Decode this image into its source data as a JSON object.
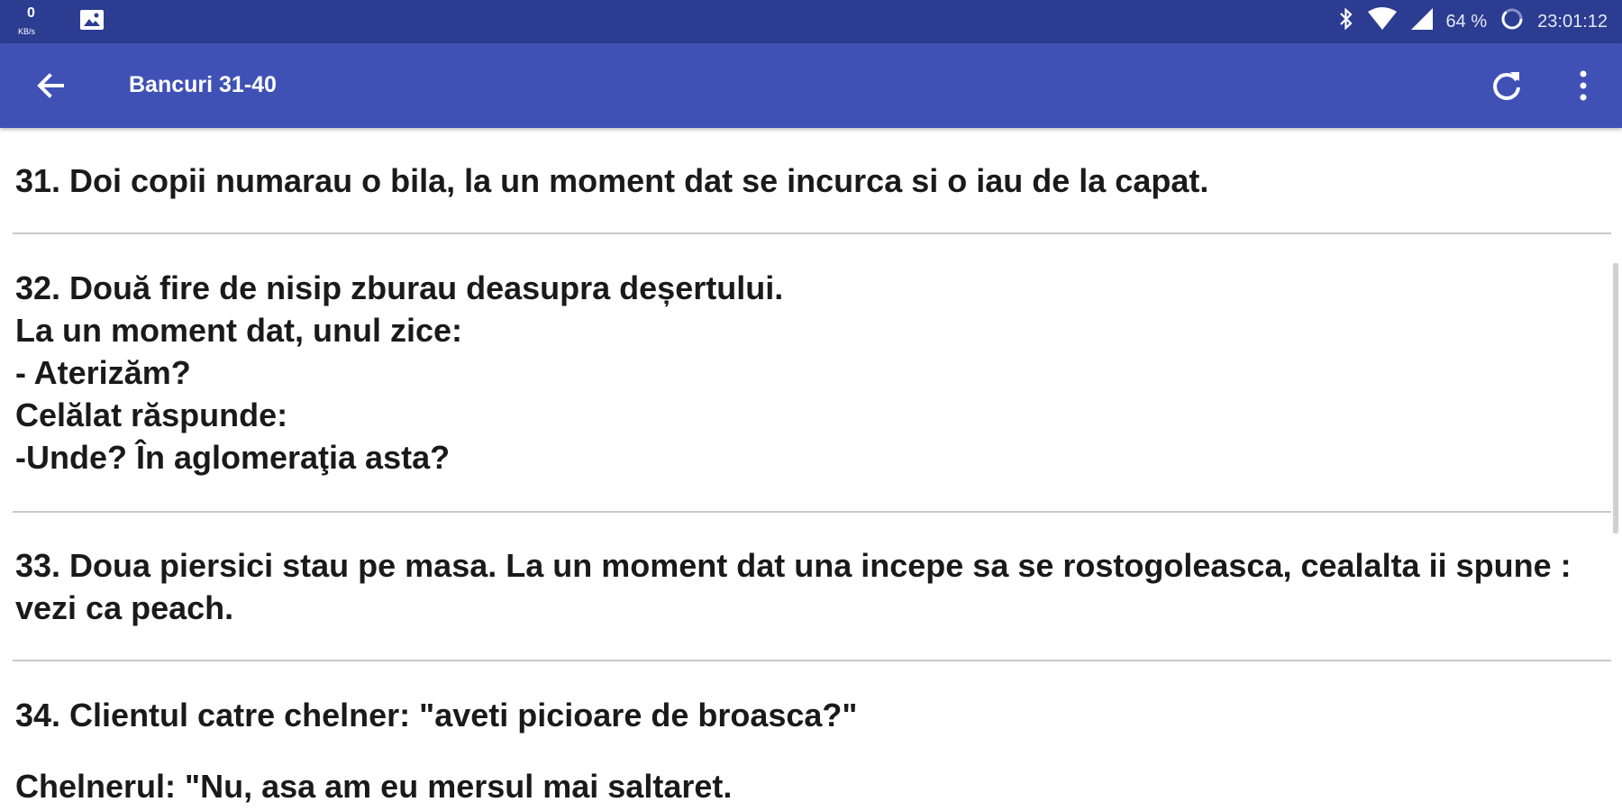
{
  "status_bar": {
    "net_speed_value": "0",
    "net_speed_unit": "KB/s",
    "battery": "64 %",
    "time": "23:01:12"
  },
  "app_bar": {
    "title": "Bancuri 31-40"
  },
  "jokes": [
    {
      "text": "31. Doi copii numarau o bila, la un moment dat se incurca si o iau de la capat."
    },
    {
      "text": "32. Două fire de nisip zburau deasupra deșertului.\nLa un moment dat, unul zice:\n- Aterizăm?\nCelălat răspunde:\n-Unde? În aglomeraţia asta?"
    },
    {
      "text": "33. Doua piersici stau pe masa. La un moment dat una incepe sa se rostogoleasca, cealalta ii spune : vezi ca peach."
    },
    {
      "text": "34. Clientul catre chelner: \"aveti picioare de broasca?\""
    },
    {
      "text": "Chelnerul: \"Nu, asa am eu mersul mai saltaret."
    }
  ],
  "icons": {
    "back": "arrow-left-icon",
    "refresh": "refresh-icon",
    "overflow": "more-vert-icon",
    "bluetooth": "bluetooth-icon",
    "wifi": "wifi-icon",
    "signal": "signal-icon",
    "battery": "battery-icon",
    "gallery": "image-icon"
  },
  "colors": {
    "app_bar": "#3f51b5",
    "status_bar": "#2c3d91",
    "divider": "#c8c8c8"
  }
}
